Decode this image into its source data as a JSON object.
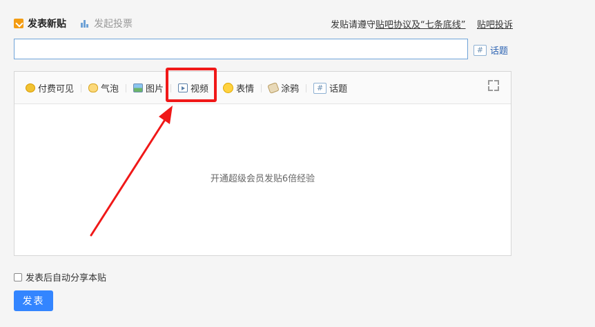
{
  "header": {
    "tab_new_post": "发表新贴",
    "tab_new_vote": "发起投票",
    "rules_prefix": "发贴请遵守",
    "rules_link": "贴吧协议及“七条底线”",
    "complaint_link": "贴吧投诉"
  },
  "title_input": {
    "value": "",
    "placeholder": ""
  },
  "topic": {
    "icon_text": "#",
    "label": "话题"
  },
  "toolbar": {
    "items": [
      {
        "label": "付费可见"
      },
      {
        "label": "气泡"
      },
      {
        "label": "图片"
      },
      {
        "label": "视频"
      },
      {
        "label": "表情"
      },
      {
        "label": "涂鸦"
      },
      {
        "label": "话题"
      }
    ]
  },
  "editor": {
    "placeholder": "开通超级会员发贴6倍经验"
  },
  "auto_share": {
    "label": "发表后自动分享本贴",
    "checked": false
  },
  "submit_label": "发表",
  "colors": {
    "accent": "#3385ff",
    "highlight": "#f01818",
    "link": "#2d64b3"
  }
}
